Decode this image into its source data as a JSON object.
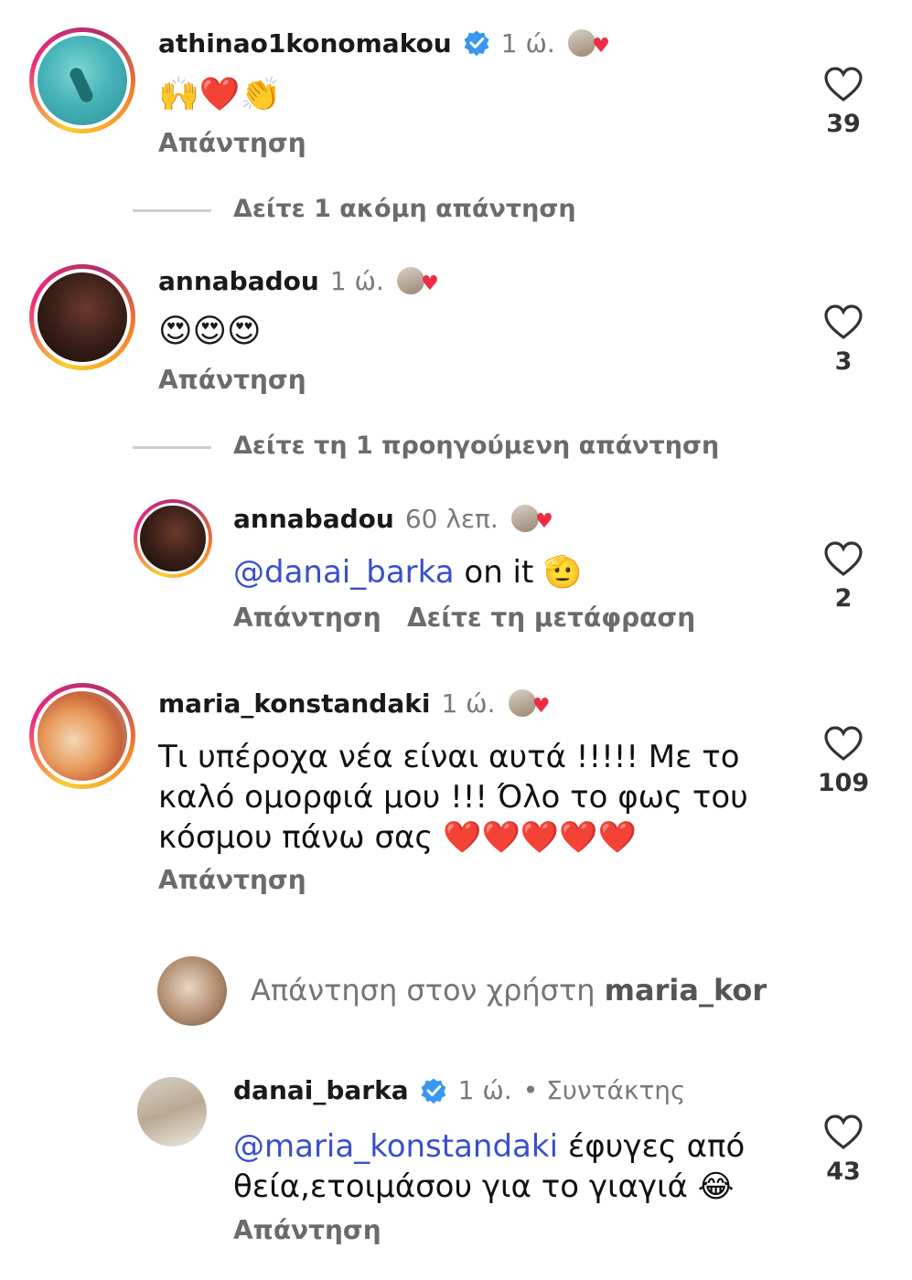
{
  "comments": [
    {
      "username": "athinao1konomakou",
      "verified": true,
      "time": "1 ώ.",
      "text": "🙌❤️👏",
      "reply_label": "Απάντηση",
      "likes": "39"
    },
    {
      "username": "annabadou",
      "verified": false,
      "time": "1 ώ.",
      "text": "😍😍😍",
      "reply_label": "Απάντηση",
      "likes": "3"
    },
    {
      "username": "annabadou",
      "verified": false,
      "time": "60 λεπ.",
      "mention": "@danai_barka",
      "text": " on it 🫡",
      "reply_label": "Απάντηση",
      "translate_label": "Δείτε τη μετάφραση",
      "likes": "2"
    },
    {
      "username": "maria_konstandaki",
      "verified": false,
      "time": "1 ώ.",
      "text_line1": "Τι υπέροχα νέα είναι αυτά !!!!! Με το",
      "text_line2": "καλό ομορφιά μου !!! Όλο το φως του",
      "text_line3": "κόσμου πάνω σας ❤️❤️❤️❤️❤️",
      "reply_label": "Απάντηση",
      "likes": "109"
    },
    {
      "username": "danai_barka",
      "verified": true,
      "time": "1 ώ.",
      "role": "• Συντάκτης",
      "mention": "@maria_konstandaki",
      "text_line1": " έφυγες από",
      "text_line2": "θεία,ετοιμάσου για το γιαγιά 😂",
      "reply_label": "Απάντηση",
      "likes": "43"
    }
  ],
  "view_more_1": "Δείτε 1 ακόμη απάντηση",
  "view_prev_1": "Δείτε τη 1 προηγούμενη απάντηση",
  "reply_box": {
    "prefix": "Απάντηση στον χρήστη ",
    "user": "maria_kor"
  },
  "colors": {
    "mention": "#3a50c8",
    "verified": "#3897f0",
    "heart_red": "#ed2d47",
    "muted": "#6b6b6b"
  },
  "icons": [
    "heart-outline-icon",
    "verified-badge-icon",
    "liked-by-author-icon"
  ]
}
